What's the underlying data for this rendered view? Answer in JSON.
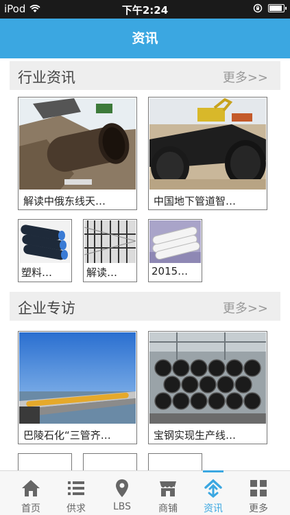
{
  "status_bar": {
    "carrier": "iPod",
    "time": "下午2:24"
  },
  "nav": {
    "title": "资讯"
  },
  "sections": [
    {
      "title": "行业资讯",
      "more": "更多>>",
      "big": [
        {
          "caption": "解读中俄东线天…"
        },
        {
          "caption": "中国地下管道智…"
        }
      ],
      "small": [
        {
          "caption": "塑料…"
        },
        {
          "caption": "解读…"
        },
        {
          "caption": "2015…"
        }
      ]
    },
    {
      "title": "企业专访",
      "more": "更多>>",
      "big": [
        {
          "caption": "巴陵石化“三管齐…"
        },
        {
          "caption": "宝钢实现生产线…"
        }
      ]
    }
  ],
  "tabs": [
    {
      "label": "首页",
      "icon": "home-icon"
    },
    {
      "label": "供求",
      "icon": "list-icon"
    },
    {
      "label": "LBS",
      "icon": "location-pin-icon"
    },
    {
      "label": "商铺",
      "icon": "shop-icon"
    },
    {
      "label": "资讯",
      "icon": "news-icon",
      "active": true
    },
    {
      "label": "更多",
      "icon": "grid-icon"
    }
  ],
  "colors": {
    "accent": "#3ba7e1",
    "status_bar": "#1a1a1a"
  }
}
